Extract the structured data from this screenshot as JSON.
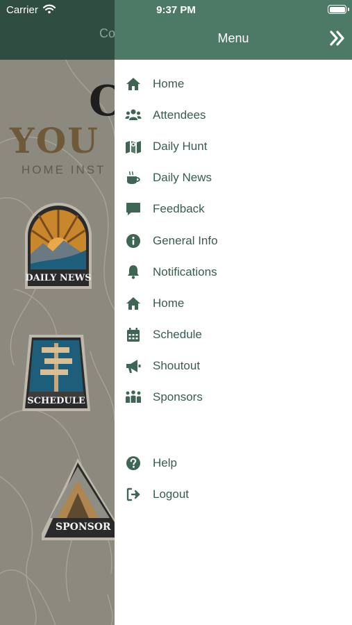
{
  "status_bar": {
    "carrier": "Carrier",
    "time": "9:37 PM"
  },
  "background": {
    "header_title": "Co",
    "hero": {
      "line1": "C",
      "line2": "YOU",
      "line3": "HOME INST"
    },
    "badges": [
      {
        "label": "DAILY NEWS"
      },
      {
        "label": "SCHEDULE"
      },
      {
        "label": "SPONSOR"
      }
    ]
  },
  "drawer": {
    "title": "Menu",
    "items": [
      {
        "label": "Home",
        "icon": "home-icon"
      },
      {
        "label": "Attendees",
        "icon": "users-icon"
      },
      {
        "label": "Daily Hunt",
        "icon": "map-icon"
      },
      {
        "label": "Daily News",
        "icon": "coffee-icon"
      },
      {
        "label": "Feedback",
        "icon": "comment-icon"
      },
      {
        "label": "General Info",
        "icon": "info-icon"
      },
      {
        "label": "Notifications",
        "icon": "bell-icon"
      },
      {
        "label": "Home",
        "icon": "home-icon"
      },
      {
        "label": "Schedule",
        "icon": "calendar-icon"
      },
      {
        "label": "Shoutout",
        "icon": "megaphone-icon"
      },
      {
        "label": "Sponsors",
        "icon": "people-group-icon"
      }
    ],
    "bottom_items": [
      {
        "label": "Help",
        "icon": "help-icon"
      },
      {
        "label": "Logout",
        "icon": "logout-icon"
      }
    ]
  },
  "colors": {
    "header_bg": "#2f4d40",
    "drawer_header_bg": "#4d7a67",
    "menu_text": "#3a5c4d",
    "icon_color": "#3f6655"
  }
}
